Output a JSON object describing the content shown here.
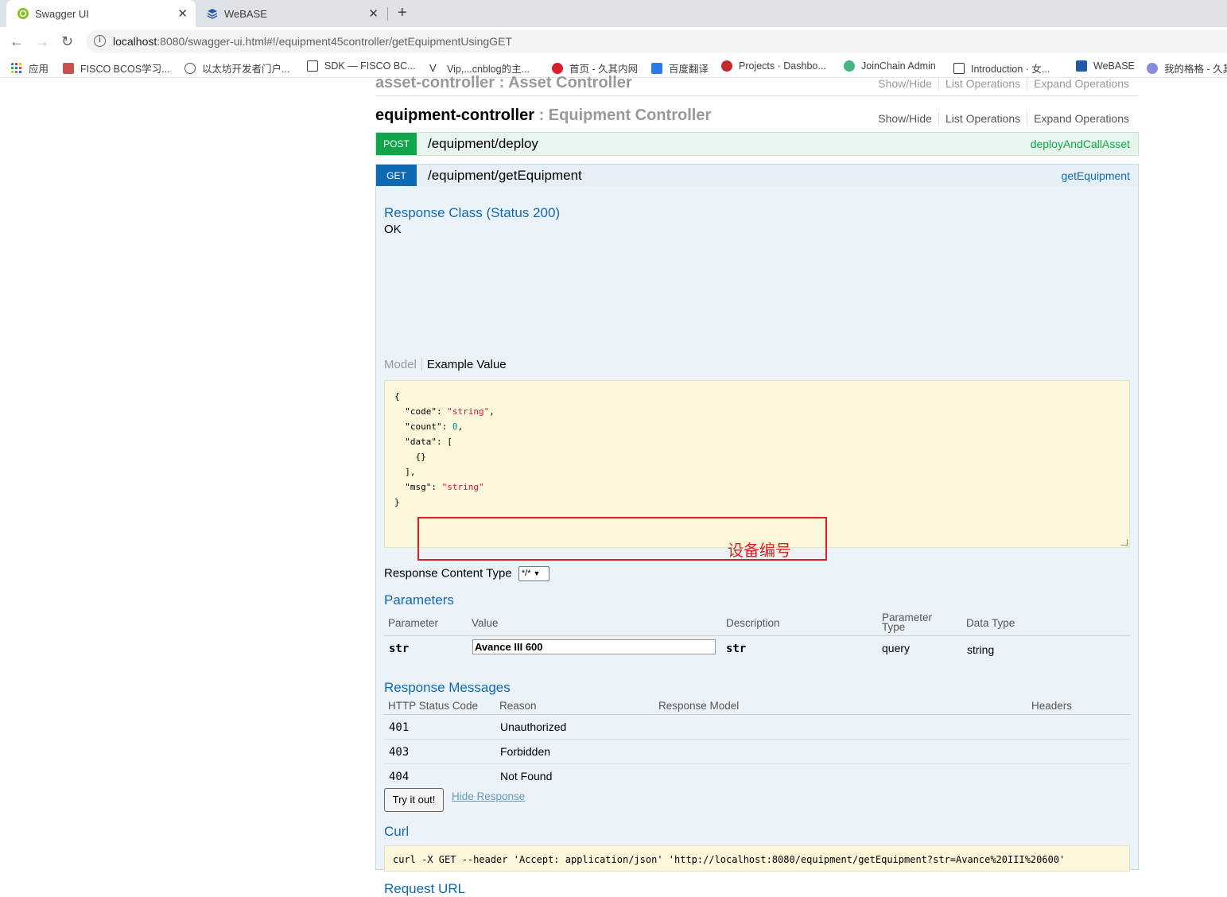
{
  "browser": {
    "tabs": [
      {
        "title": "Swagger UI",
        "active": true
      },
      {
        "title": "WeBASE",
        "active": false
      }
    ],
    "url_host": "localhost",
    "url_rest": ":8080/swagger-ui.html#!/equipment45controller/getEquipmentUsingGET",
    "bookmarks": [
      "应用",
      "FISCO BCOS学习...",
      "以太坊开发者门户...",
      "SDK — FISCO BC...",
      "Vip,...cnblog的主...",
      "首页 - 久其内网",
      "百度翻译",
      "Projects · Dashbo...",
      "JoinChain Admin",
      "Introduction · 女...",
      "WeBASE",
      "我的格格 - 久其"
    ]
  },
  "resources": [
    {
      "name": "asset-controller",
      "desc": "Asset Controller",
      "links": [
        "Show/Hide",
        "List Operations",
        "Expand Operations"
      ]
    },
    {
      "name": "equipment-controller",
      "desc": "Equipment Controller",
      "links": [
        "Show/Hide",
        "List Operations",
        "Expand Operations"
      ]
    }
  ],
  "operations": [
    {
      "method": "POST",
      "path": "/equipment/deploy",
      "nickname": "deployAndCallAsset"
    },
    {
      "method": "GET",
      "path": "/equipment/getEquipment",
      "nickname": "getEquipment"
    }
  ],
  "detail": {
    "response_class_title": "Response Class (Status 200)",
    "response_class_value": "OK",
    "model_tab": "Model",
    "example_tab": "Example Value",
    "content_type_label": "Response Content Type",
    "content_type_value": "*/*",
    "parameters_title": "Parameters",
    "param_headers": {
      "parameter": "Parameter",
      "value": "Value",
      "description": "Description",
      "param_type_1": "Parameter",
      "param_type_2": "Type",
      "data_type": "Data Type"
    },
    "param": {
      "name": "str",
      "value": "Avance III 600",
      "description": "str",
      "type": "query",
      "data_type": "string"
    },
    "annotation": "设备编号",
    "response_messages_title": "Response Messages",
    "resp_headers": {
      "code": "HTTP Status Code",
      "reason": "Reason",
      "model": "Response Model",
      "headers": "Headers"
    },
    "responses": [
      {
        "code": "401",
        "reason": "Unauthorized"
      },
      {
        "code": "403",
        "reason": "Forbidden"
      },
      {
        "code": "404",
        "reason": "Not Found"
      }
    ],
    "try_label": "Try it out!",
    "hide_label": "Hide Response",
    "curl_title": "Curl",
    "curl_cmd": "curl -X GET --header 'Accept: application/json' 'http://localhost:8080/equipment/getEquipment?str=Avance%20III%20600'",
    "request_url_title": "Request URL"
  },
  "colors": {
    "get": "#0f6ab4",
    "post": "#10a54a",
    "annotation": "#e02020"
  }
}
